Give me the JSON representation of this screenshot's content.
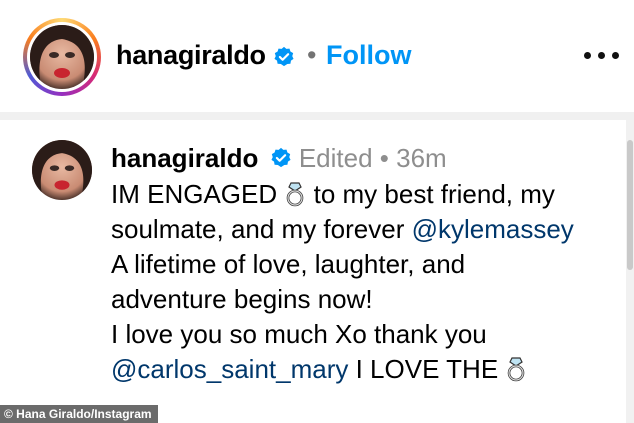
{
  "header": {
    "username": "hanagiraldo",
    "separator": "•",
    "follow_label": "Follow",
    "more_icon": "more-horizontal-icon"
  },
  "comment": {
    "username": "hanagiraldo",
    "edited_label": "Edited",
    "separator": "•",
    "time": "36m",
    "line1_text": "IM ENGAGED",
    "line1_rest": "to my best friend, my",
    "line2_text": "soulmate, and my forever",
    "line2_mention": "@kylemassey",
    "line3": "A lifetime of love, laughter, and",
    "line4": "adventure begins now!",
    "line5": "I love you so much Xo thank you",
    "line6_mention": "@carlos_saint_mary",
    "line6_text": "I LOVE THE",
    "emoji": "ring-icon"
  },
  "credit": "© Hana Giraldo/Instagram",
  "colors": {
    "follow": "#0095f6",
    "verified": "#0095f6",
    "mention": "#00376b",
    "meta": "#8e8e8e"
  }
}
